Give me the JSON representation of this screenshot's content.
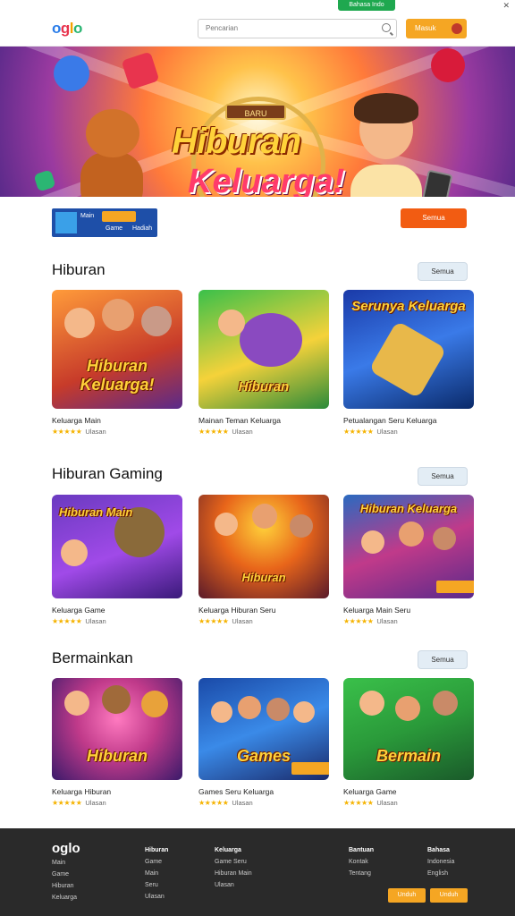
{
  "topbar": {
    "promo_label": "Bahasa Indo",
    "close_icon": "x-icon"
  },
  "header": {
    "logo": [
      "o",
      "g",
      "l",
      "o"
    ],
    "search_placeholder": "Pencarian",
    "login_label": "Masuk"
  },
  "hero": {
    "badge": "BARU",
    "title_line1": "Hiburan",
    "title_line2": "Keluarga!"
  },
  "subbar": {
    "chip_left": "Main",
    "chip_mid": "Game",
    "chip_right": "Hadiah",
    "action_label": "Semua"
  },
  "sections": [
    {
      "title": "Hiburan",
      "see_all": "Semua",
      "cards": [
        {
          "title_art": "Hiburan Keluarga!",
          "label": "Keluarga Main",
          "rating": "★★★★★",
          "meta": "Ulasan"
        },
        {
          "title_art": "Hiburan",
          "label": "Mainan Teman Keluarga",
          "rating": "★★★★★",
          "meta": "Ulasan"
        },
        {
          "title_art": "Serunya Keluarga",
          "label": "Petualangan Seru Keluarga",
          "rating": "★★★★★",
          "meta": "Ulasan"
        }
      ]
    },
    {
      "title": "Hiburan Gaming",
      "see_all": "Semua",
      "cards": [
        {
          "title_art": "Hiburan Main",
          "label": "Keluarga Game",
          "rating": "★★★★★",
          "meta": "Ulasan"
        },
        {
          "title_art": "Hiburan",
          "label": "Keluarga Hiburan Seru",
          "rating": "★★★★★",
          "meta": "Ulasan"
        },
        {
          "title_art": "Hiburan Keluarga",
          "label": "Keluarga Main Seru",
          "rating": "★★★★★",
          "meta": "Ulasan"
        }
      ]
    },
    {
      "title": "Bermainkan",
      "see_all": "Semua",
      "cards": [
        {
          "title_art": "Hiburan",
          "label": "Keluarga Hiburan",
          "rating": "★★★★★",
          "meta": "Ulasan"
        },
        {
          "title_art": "Games",
          "label": "Games Seru Keluarga",
          "rating": "★★★★★",
          "meta": "Ulasan"
        },
        {
          "title_art": "Bermain",
          "label": "Keluarga Game",
          "rating": "★★★★★",
          "meta": "Ulasan"
        }
      ]
    }
  ],
  "footer": {
    "logo": "oglo",
    "columns": [
      {
        "head": "",
        "items": [
          "Main",
          "Game",
          "Hiburan",
          "Keluarga"
        ]
      },
      {
        "head": "Hiburan",
        "items": [
          "Game",
          "Main",
          "Seru",
          "Ulasan"
        ]
      },
      {
        "head": "Keluarga",
        "items": [
          "Game Seru",
          "Hiburan Main",
          "Ulasan"
        ]
      },
      {
        "head": "Bantuan",
        "items": [
          "Kontak",
          "Tentang"
        ]
      },
      {
        "head": "Bahasa",
        "items": [
          "Indonesia",
          "English"
        ]
      }
    ],
    "btn1": "Unduh",
    "btn2": "Unduh"
  },
  "colors": {
    "accent": "#f5a623",
    "cta": "#f25c12",
    "footer_bg": "#2a2a2a"
  }
}
